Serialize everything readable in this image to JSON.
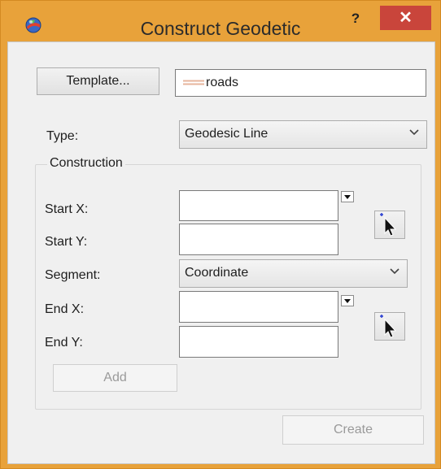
{
  "window": {
    "title": "Construct Geodetic",
    "help_label": "?",
    "close_label": "✕"
  },
  "template": {
    "button_label": "Template...",
    "value": "roads",
    "swatch_color": "#e7b49c"
  },
  "type": {
    "label": "Type:",
    "selected": "Geodesic Line"
  },
  "construction": {
    "title": "Construction",
    "start_x_label": "Start X:",
    "start_x_value": "",
    "start_y_label": "Start Y:",
    "start_y_value": "",
    "segment_label": "Segment:",
    "segment_selected": "Coordinate",
    "end_x_label": "End X:",
    "end_x_value": "",
    "end_y_label": "End Y:",
    "end_y_value": "",
    "add_label": "Add"
  },
  "footer": {
    "create_label": "Create"
  },
  "icons": {
    "app": "geodetic-globe-icon",
    "pick_start": "map-pick-cursor-icon",
    "pick_end": "map-pick-cursor-icon",
    "dropdown": "chevron-down-icon"
  },
  "colors": {
    "frame": "#e8a23a",
    "close": "#c9453b"
  }
}
